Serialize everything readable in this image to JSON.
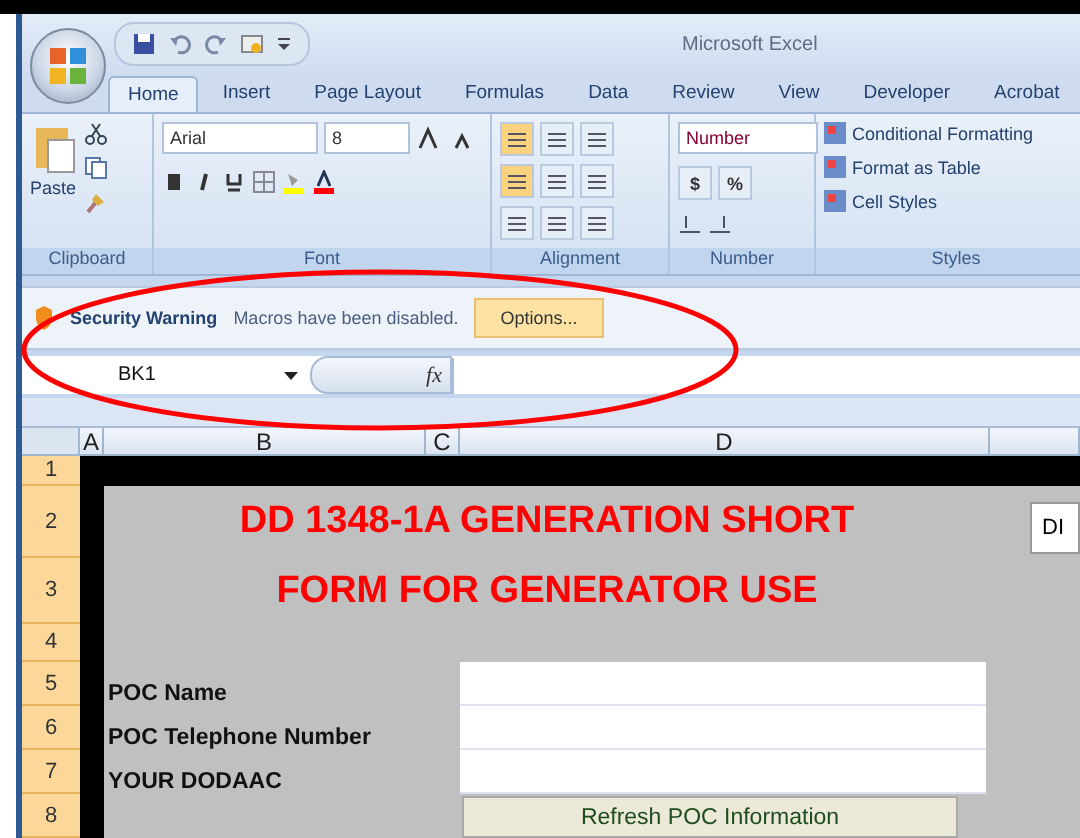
{
  "window": {
    "title": "Microsoft Excel"
  },
  "tabs": [
    {
      "label": "Home",
      "selected": true
    },
    {
      "label": "Insert",
      "selected": false
    },
    {
      "label": "Page Layout",
      "selected": false
    },
    {
      "label": "Formulas",
      "selected": false
    },
    {
      "label": "Data",
      "selected": false
    },
    {
      "label": "Review",
      "selected": false
    },
    {
      "label": "View",
      "selected": false
    },
    {
      "label": "Developer",
      "selected": false
    },
    {
      "label": "Acrobat",
      "selected": false
    }
  ],
  "ribbon": {
    "clipboard": {
      "paste_label": "Paste",
      "group_label": "Clipboard"
    },
    "font": {
      "font_name": "Arial",
      "font_size": "8",
      "group_label": "Font"
    },
    "alignment": {
      "group_label": "Alignment"
    },
    "number": {
      "format": "Number",
      "currency": "$",
      "percent": "%",
      "group_label": "Number"
    },
    "styles": {
      "items": [
        "Conditional Formatting",
        "Format as Table",
        "Cell Styles"
      ],
      "group_label": "Styles"
    }
  },
  "security_bar": {
    "title": "Security Warning",
    "message": "Macros have been disabled.",
    "button": "Options..."
  },
  "formula_bar": {
    "name_box": "BK1",
    "function_label": "fx"
  },
  "sheet": {
    "columns": [
      "A",
      "B",
      "C",
      "D"
    ],
    "rows": [
      "1",
      "2",
      "3",
      "4",
      "5",
      "6",
      "7",
      "8"
    ],
    "title_lines": [
      "DD 1348-1A GENERATION SHORT",
      "FORM FOR GENERATOR USE"
    ],
    "side_field": "DI",
    "fields": [
      {
        "label": "POC Name"
      },
      {
        "label": "POC Telephone Number"
      },
      {
        "label": "YOUR DODAAC"
      }
    ],
    "button": "Refresh POC Information"
  }
}
